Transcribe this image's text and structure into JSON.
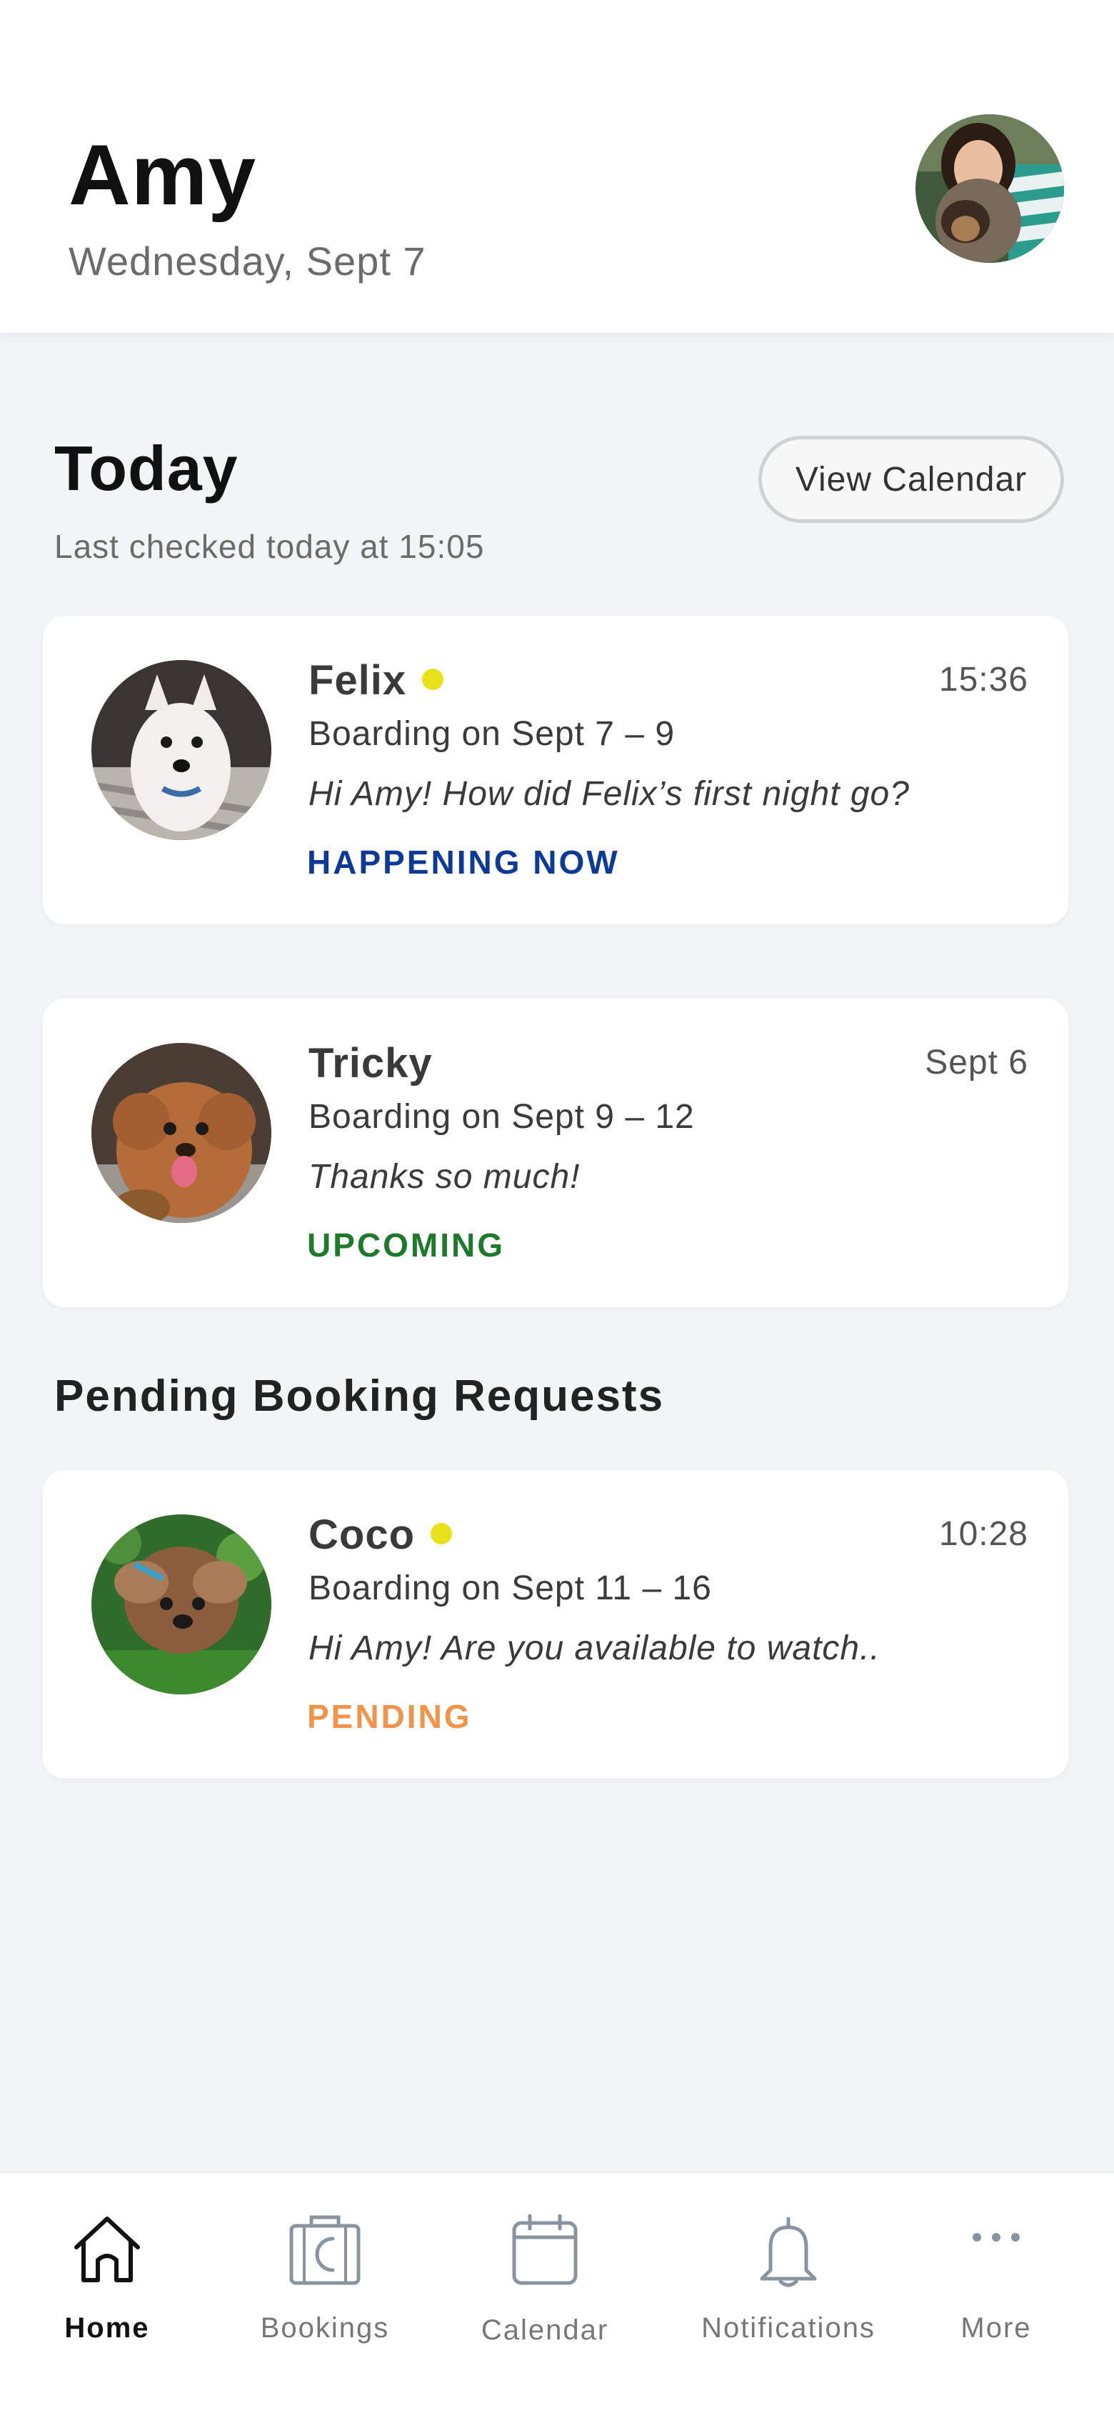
{
  "header": {
    "user_name": "Amy",
    "date": "Wednesday, Sept 7",
    "avatar_icon": "user-avatar-photo"
  },
  "today": {
    "title": "Today",
    "last_checked": "Last checked today at 15:05",
    "view_calendar_label": "View Calendar"
  },
  "today_cards": [
    {
      "pet_name": "Felix",
      "unread": true,
      "time": "15:36",
      "booking": "Boarding on Sept 7 – 9",
      "message": "Hi Amy! How did Felix’s first night go?",
      "status": "HAPPENING NOW",
      "status_color": "#0d3a96"
    },
    {
      "pet_name": "Tricky",
      "unread": false,
      "time": "Sept 6",
      "booking": "Boarding on Sept 9 – 12",
      "message": "Thanks so much!",
      "status": "UPCOMING",
      "status_color": "#1d7a2b"
    }
  ],
  "pending": {
    "title": "Pending Booking Requests",
    "cards": [
      {
        "pet_name": "Coco",
        "unread": true,
        "time": "10:28",
        "booking": "Boarding on Sept 11 – 16",
        "message": "Hi Amy! Are you available to watch..",
        "status": "PENDING",
        "status_color": "#f2934a"
      }
    ]
  },
  "unread_dot_color": "#e8e21a",
  "tabbar": {
    "items": [
      {
        "label": "Home",
        "icon": "home-icon",
        "active": true
      },
      {
        "label": "Bookings",
        "icon": "suitcase-moon-icon",
        "active": false
      },
      {
        "label": "Calendar",
        "icon": "calendar-icon",
        "active": false
      },
      {
        "label": "Notifications",
        "icon": "bell-icon",
        "active": false
      },
      {
        "label": "More",
        "icon": "more-dots-icon",
        "active": false
      }
    ]
  }
}
